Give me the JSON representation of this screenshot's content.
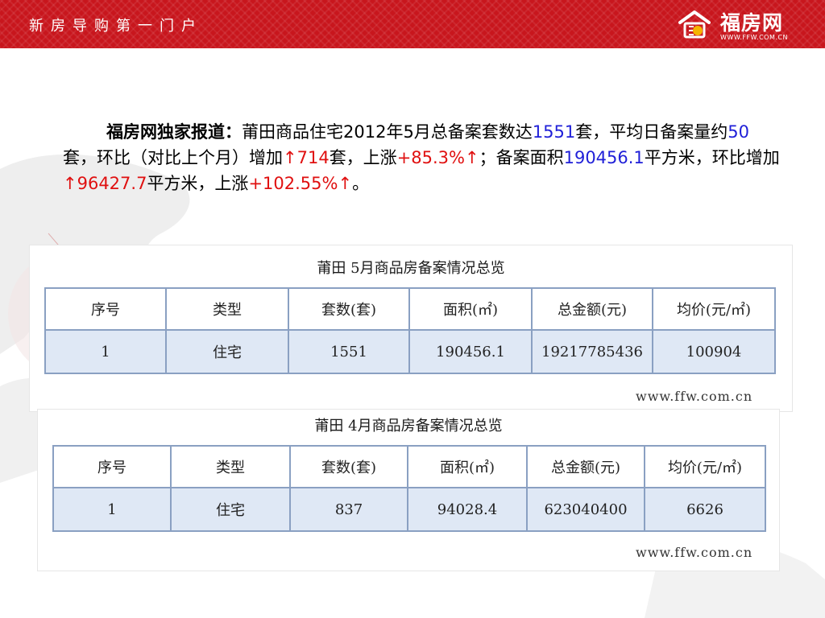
{
  "header": {
    "slogan": "新房导购第一门户",
    "logo_name": "福房网",
    "logo_url": "WWW.FFW.COM.CN"
  },
  "report": {
    "lead": "福房网独家报道：",
    "t1": "莆田商品住宅2012年5月总备案套数达",
    "v_total_units": "1551",
    "t2": "套，平均日备案量约",
    "v_daily": "50",
    "t3": "套，环比（对比上个月）增加",
    "v_unit_increase": "↑714",
    "t4": "套，上涨",
    "v_unit_pct": "+85.3%↑",
    "t5": "；备案面积",
    "v_area": "190456.1",
    "t6": "平方米，环比增加",
    "v_area_increase": "↑96427.7",
    "t7": "平方米，上涨",
    "v_area_pct": "+102.55%↑",
    "t8": "。"
  },
  "tables": [
    {
      "title": "莆田 5月商品房备案情况总览",
      "headers": [
        "序号",
        "类型",
        "套数(套)",
        "面积(㎡)",
        "总金额(元)",
        "均价(元/㎡)"
      ],
      "row": [
        "1",
        "住宅",
        "1551",
        "190456.1",
        "19217785436",
        "100904"
      ],
      "watermark": "www.ffw.com.cn"
    },
    {
      "title": "莆田 4月商品房备案情况总览",
      "headers": [
        "序号",
        "类型",
        "套数(套)",
        "面积(㎡)",
        "总金额(元)",
        "均价(元/㎡)"
      ],
      "row": [
        "1",
        "住宅",
        "837",
        "94028.4",
        "623040400",
        "6626"
      ],
      "watermark": "www.ffw.com.cn"
    }
  ],
  "colors": {
    "banner": "#c8161d",
    "highlight_blue": "#1f1fd8",
    "highlight_red": "#e01010",
    "table_border": "#8aa0c2",
    "table_row": "#dfe8f5"
  },
  "icons": {
    "logo": "house-logo-icon",
    "background": "world-map-decoration"
  }
}
